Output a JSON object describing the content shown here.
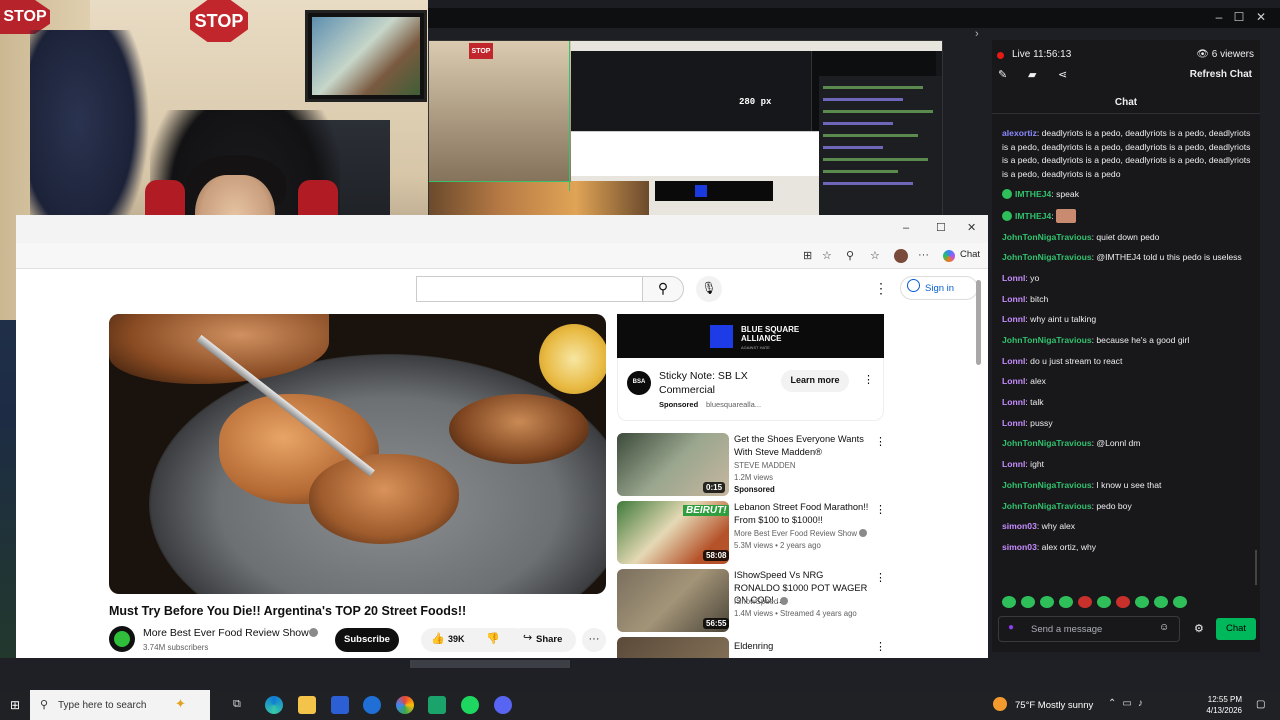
{
  "stream": {
    "live_label": "Live 11:56:13",
    "viewers": "6 viewers",
    "refresh_label": "Refresh Chat",
    "chat_title": "Chat",
    "input_placeholder": "Send a message",
    "chat_button": "Chat",
    "messages": [
      {
        "user": "alexortiz",
        "color": "u-a",
        "badge": false,
        "text": "deadlyriots is a pedo, deadlyriots is a pedo, deadlyriots is a pedo, deadlyriots is a pedo, deadlyriots is a pedo, deadlyriots is a pedo, deadlyriots is a pedo, deadlyriots is a pedo, deadlyriots is a pedo, deadlyriots is a pedo"
      },
      {
        "user": "IMTHEJ4",
        "color": "u-g",
        "badge": true,
        "text": "speak"
      },
      {
        "user": "IMTHEJ4",
        "color": "u-g",
        "badge": true,
        "text": "",
        "emote": true
      },
      {
        "user": "JohnTonNigaTravious",
        "color": "u-g",
        "badge": false,
        "text": "quiet down pedo"
      },
      {
        "user": "JohnTonNigaTravious",
        "color": "u-g",
        "badge": false,
        "text": "@IMTHEJ4 told u this pedo is useless"
      },
      {
        "user": "Lonnl",
        "color": "u-p",
        "badge": false,
        "text": "yo"
      },
      {
        "user": "Lonnl",
        "color": "u-p",
        "badge": false,
        "text": "bitch"
      },
      {
        "user": "Lonnl",
        "color": "u-p",
        "badge": false,
        "text": "why aint u talking"
      },
      {
        "user": "JohnTonNigaTravious",
        "color": "u-g",
        "badge": false,
        "text": "because he's a good girl"
      },
      {
        "user": "Lonnl",
        "color": "u-p",
        "badge": false,
        "text": "do u just stream to react"
      },
      {
        "user": "Lonnl",
        "color": "u-p",
        "badge": false,
        "text": "alex"
      },
      {
        "user": "Lonnl",
        "color": "u-p",
        "badge": false,
        "text": "talk"
      },
      {
        "user": "Lonnl",
        "color": "u-p",
        "badge": false,
        "text": "pussy"
      },
      {
        "user": "JohnTonNigaTravious",
        "color": "u-g",
        "badge": false,
        "text": "@Lonnl dm"
      },
      {
        "user": "Lonnl",
        "color": "u-p",
        "badge": false,
        "text": "ight"
      },
      {
        "user": "JohnTonNigaTravious",
        "color": "u-g",
        "badge": false,
        "text": "I know u see that"
      },
      {
        "user": "JohnTonNigaTravious",
        "color": "u-g",
        "badge": false,
        "text": "pedo boy"
      },
      {
        "user": "simon03",
        "color": "u-p",
        "badge": false,
        "text": "why alex"
      },
      {
        "user": "simon03",
        "color": "u-p",
        "badge": false,
        "text": "alex ortiz, why"
      }
    ]
  },
  "obs": {
    "preview_size": "280 px"
  },
  "webcam": {
    "stop_sign": "STOP",
    "stop_sign_partial": "STOP"
  },
  "browser": {
    "chat_label": "Chat",
    "sign_in": "Sign in",
    "video": {
      "title": "Must Try Before You Die!! Argentina's TOP 20 Street Foods!!",
      "channel": "More Best Ever Food Review Show",
      "subscribers": "3.74M subscribers",
      "subscribe": "Subscribe",
      "likes": "39K",
      "share": "Share"
    },
    "ad": {
      "brand": "BLUE SQUARE ALLIANCE",
      "brand_tag": "AGAINST HATE",
      "logo_text": "BSA",
      "title": "Sticky Note: SB LX Commercial",
      "sponsored": "Sponsored",
      "domain": "bluesquarealla...",
      "learn_more": "Learn more"
    },
    "recommendations": [
      {
        "title": "Get the Shoes Everyone Wants With Steve Madden®",
        "channel": "STEVE MADDEN",
        "meta": "1.2M views",
        "sponsored": "Sponsored",
        "duration": "0:15"
      },
      {
        "title": "Lebanon Street Food Marathon!! From $100 to $1000!!",
        "channel": "More Best Ever Food Review Show",
        "meta": "5.3M views • 2 years ago",
        "duration": "58:08",
        "thumb_text": "BEIRUT!"
      },
      {
        "title": "IShowSpeed Vs NRG RONALDO $1000 POT WAGER ON COD! ...",
        "channel": "IShowSpeed",
        "meta": "1.4M views • Streamed 4 years ago",
        "duration": "56:55"
      },
      {
        "title": "Eldenring",
        "channel": "",
        "meta": "",
        "duration": ""
      }
    ]
  },
  "taskbar": {
    "search_placeholder": "Type here to search",
    "weather": "75°F  Mostly sunny",
    "time": "12:55 PM",
    "date": "4/13/2026"
  }
}
